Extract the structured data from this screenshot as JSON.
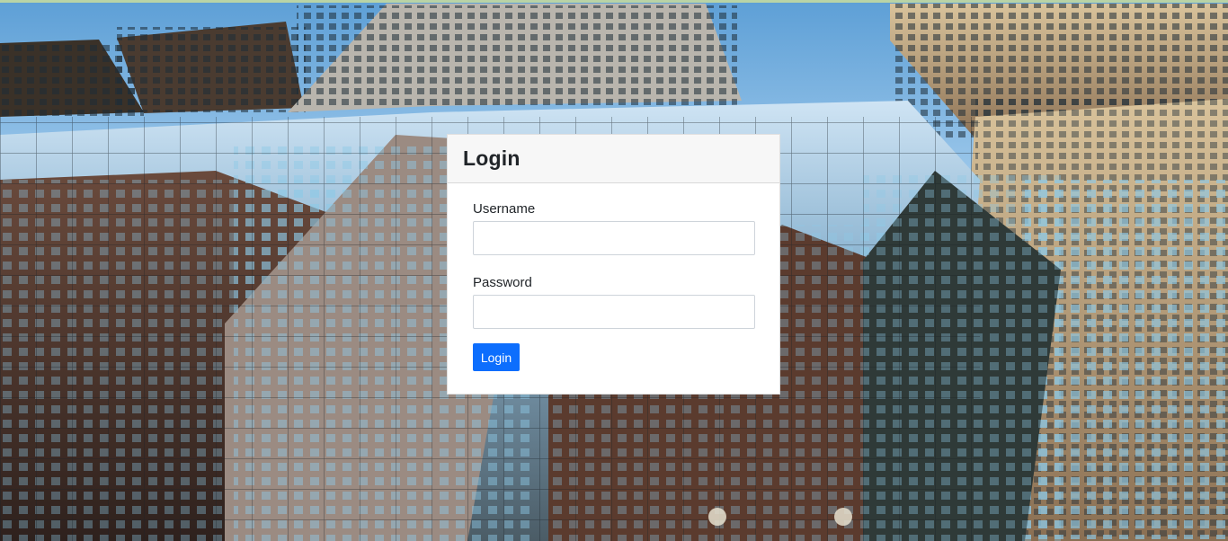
{
  "login_card": {
    "title": "Login",
    "username_label": "Username",
    "username_value": "",
    "password_label": "Password",
    "password_value": "",
    "submit_label": "Login"
  },
  "colors": {
    "primary": "#0d6efd",
    "header_bg": "#f7f7f7"
  }
}
